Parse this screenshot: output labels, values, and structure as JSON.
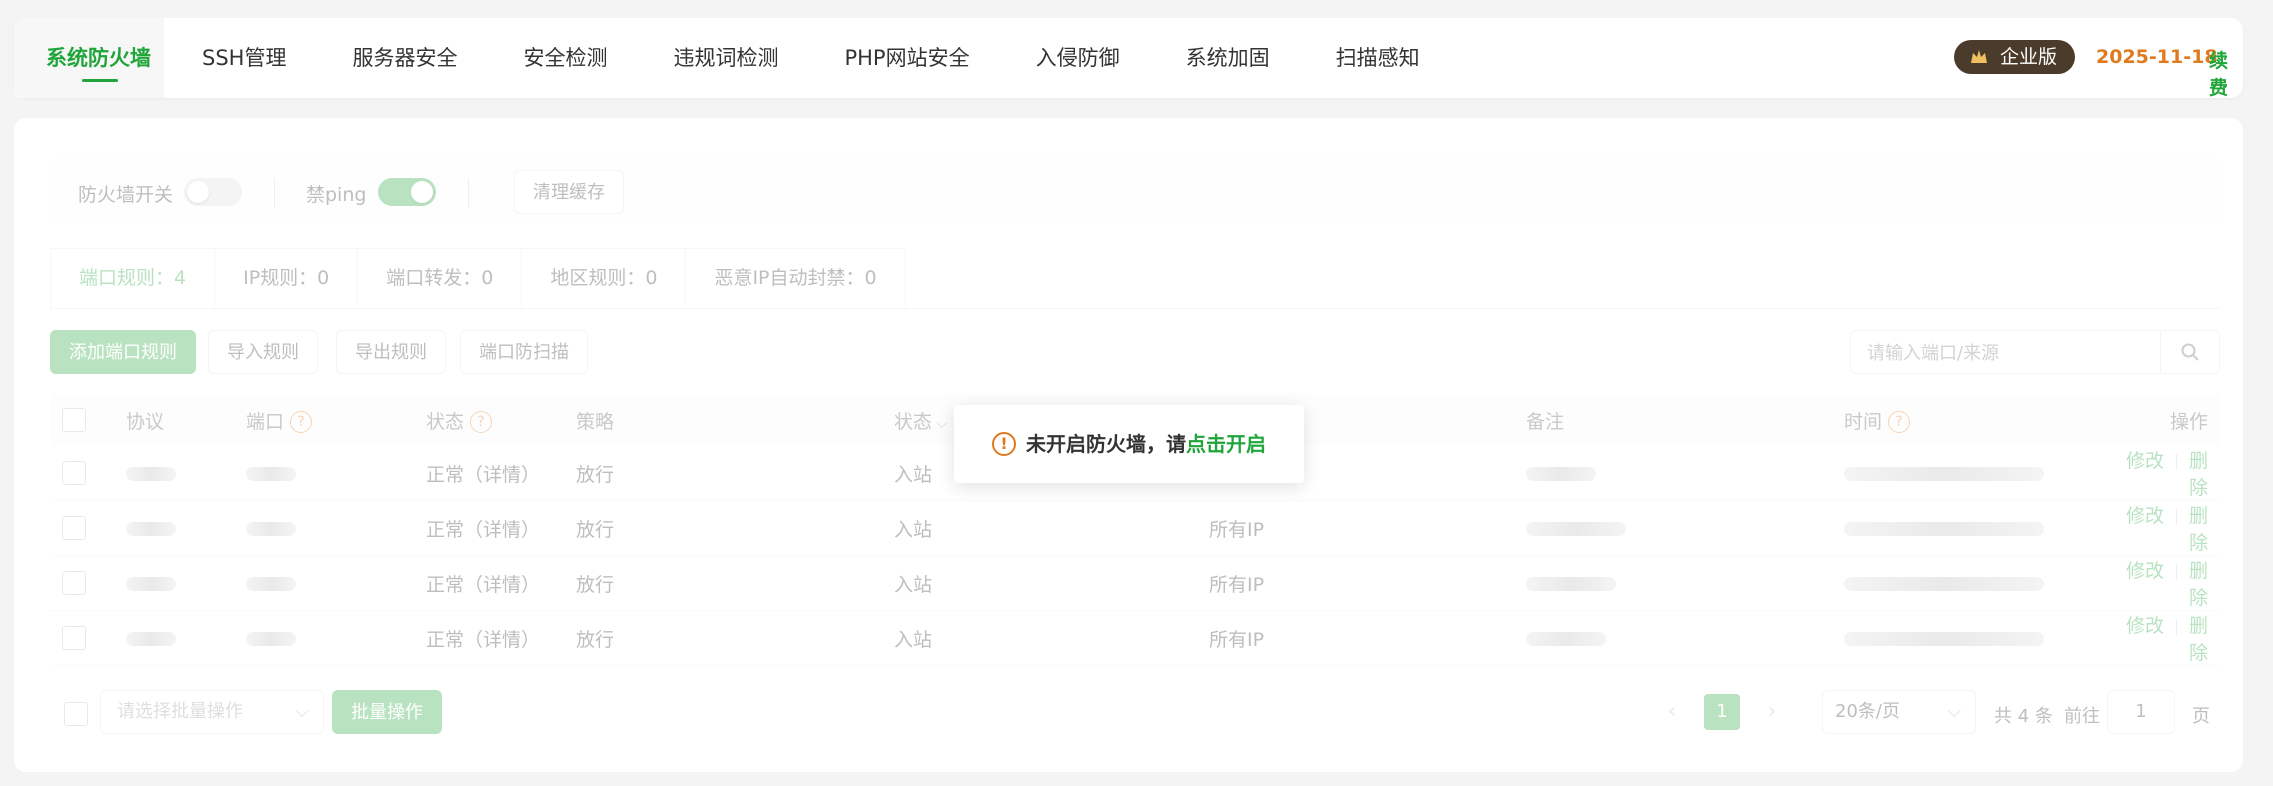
{
  "nav": {
    "tabs": [
      "系统防火墙",
      "SSH管理",
      "服务器安全",
      "安全检测",
      "违规词检测",
      "PHP网站安全",
      "入侵防御",
      "系统加固",
      "扫描感知"
    ],
    "edition": "企业版",
    "expire_date": "2025-11-18",
    "renew_label": "续费"
  },
  "controls": {
    "firewall_switch_label": "防火墙开关",
    "firewall_on": false,
    "ping_label": "禁ping",
    "ping_on": true,
    "clear_cache_label": "清理缓存"
  },
  "subtabs": [
    "端口规则：4",
    "IP规则：0",
    "端口转发：0",
    "地区规则：0",
    "恶意IP自动封禁：0"
  ],
  "toolbar": {
    "add_label": "添加端口规则",
    "import_label": "导入规则",
    "export_label": "导出规则",
    "scan_label": "端口防扫描",
    "search_placeholder": "请输入端口/来源"
  },
  "table": {
    "columns": {
      "protocol": "协议",
      "port": "端口",
      "status": "状态",
      "policy": "策略",
      "direction": "状态",
      "source": "",
      "remark": "备注",
      "time": "时间",
      "actions": "操作"
    },
    "rows": [
      {
        "status": "正常（详情）",
        "policy": "放行",
        "direction": "入站",
        "source": ""
      },
      {
        "status": "正常（详情）",
        "policy": "放行",
        "direction": "入站",
        "source": "所有IP"
      },
      {
        "status": "正常（详情）",
        "policy": "放行",
        "direction": "入站",
        "source": "所有IP"
      },
      {
        "status": "正常（详情）",
        "policy": "放行",
        "direction": "入站",
        "source": "所有IP"
      }
    ],
    "edit_label": "修改",
    "delete_label": "删除"
  },
  "footer": {
    "batch_placeholder": "请选择批量操作",
    "batch_button": "批量操作",
    "current_page": "1",
    "page_size": "20条/页",
    "total_text": "共 4 条",
    "goto_label": "前往",
    "goto_value": "1",
    "page_suffix": "页"
  },
  "toast": {
    "message": "未开启防火墙，请",
    "action": "点击开启"
  },
  "colors": {
    "accent": "#20a53a",
    "warning": "#e07a1f",
    "badge_bg": "#4a3b2a"
  }
}
